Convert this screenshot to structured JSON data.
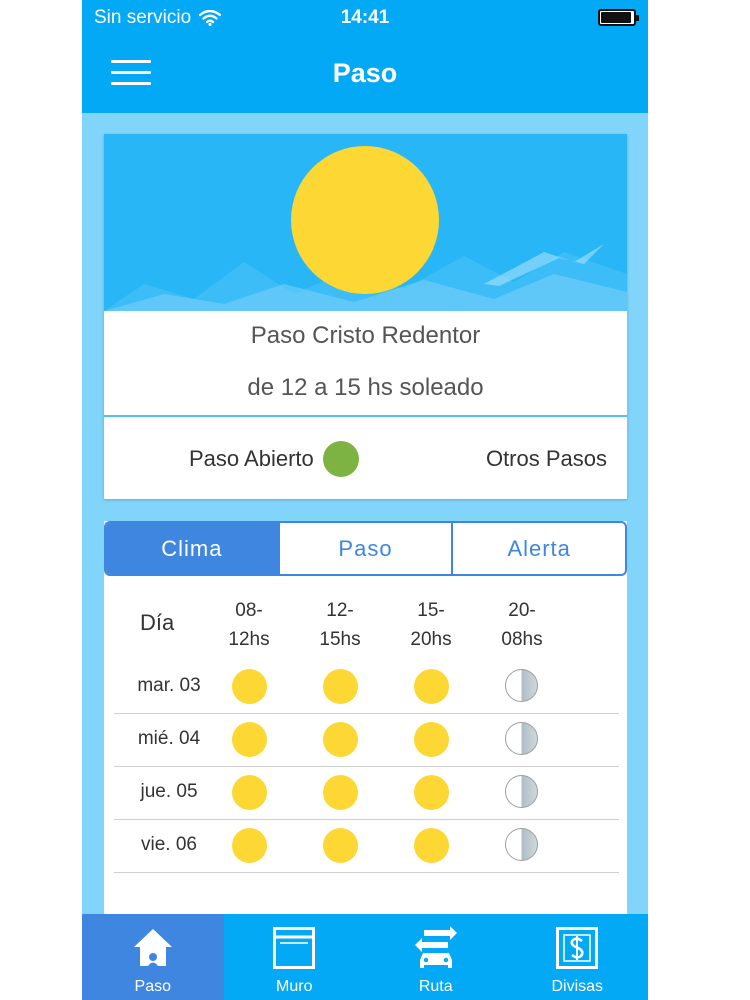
{
  "status_bar": {
    "carrier": "Sin servicio",
    "time": "14:41"
  },
  "header": {
    "title": "Paso",
    "menu_icon": "hamburger-menu-icon"
  },
  "hero": {
    "pass_name": "Paso Cristo Redentor",
    "weather_summary": "de 12 a 15 hs soleado",
    "status_label": "Paso Abierto",
    "status_color": "#7cb342",
    "other_passes_label": "Otros Pasos"
  },
  "tabs": [
    {
      "label": "Clima",
      "active": true
    },
    {
      "label": "Paso",
      "active": false
    },
    {
      "label": "Alerta",
      "active": false
    }
  ],
  "forecast": {
    "day_header": "Día",
    "time_headers": [
      {
        "line1": "08-",
        "line2": "12hs"
      },
      {
        "line1": "12-",
        "line2": "15hs"
      },
      {
        "line1": "15-",
        "line2": "20hs"
      },
      {
        "line1": "20-",
        "line2": "08hs"
      }
    ],
    "rows": [
      {
        "day": "mar. 03",
        "icons": [
          "sun",
          "sun",
          "sun",
          "moon"
        ]
      },
      {
        "day": "mié. 04",
        "icons": [
          "sun",
          "sun",
          "sun",
          "moon"
        ]
      },
      {
        "day": "jue. 05",
        "icons": [
          "sun",
          "sun",
          "sun",
          "moon"
        ]
      },
      {
        "day": "vie. 06",
        "icons": [
          "sun",
          "sun",
          "sun",
          "moon"
        ]
      }
    ]
  },
  "bottom_nav": [
    {
      "label": "Paso",
      "icon": "home-icon",
      "active": true
    },
    {
      "label": "Muro",
      "icon": "wall-icon",
      "active": false
    },
    {
      "label": "Ruta",
      "icon": "car-icon",
      "active": false
    },
    {
      "label": "Divisas",
      "icon": "currency-icon",
      "active": false
    }
  ],
  "colors": {
    "primary": "#03a9f4",
    "accent": "#3f86e0",
    "background": "#81d4fa",
    "sun": "#fdd835"
  }
}
